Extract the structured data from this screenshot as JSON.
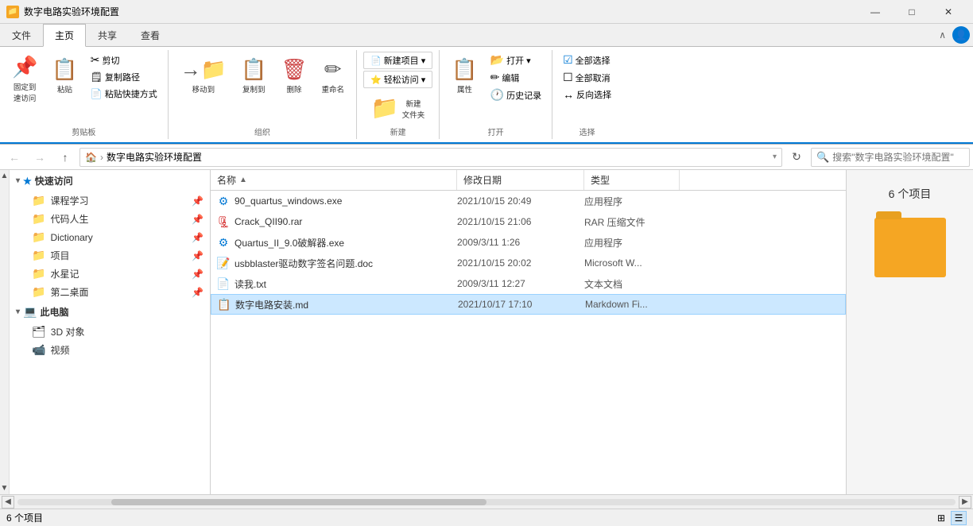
{
  "titleBar": {
    "title": "数字电路实验环境配置",
    "icon": "📁",
    "controls": {
      "minimize": "—",
      "maximize": "□",
      "close": "✕"
    }
  },
  "ribbon": {
    "tabs": [
      "文件",
      "主页",
      "共享",
      "查看"
    ],
    "activeTab": "主页",
    "groups": [
      {
        "label": "剪贴板",
        "items": [
          {
            "type": "large",
            "icon": "📌",
            "label": "固定到\n速访问"
          },
          {
            "type": "large",
            "icon": "📋",
            "label": "粘贴"
          },
          {
            "type": "col",
            "items": [
              {
                "icon": "✂",
                "label": "剪切"
              },
              {
                "icon": "🗒",
                "label": "复制路径"
              },
              {
                "icon": "📄",
                "label": "粘贴快捷方式"
              }
            ]
          }
        ]
      },
      {
        "label": "组织",
        "items": [
          {
            "type": "large",
            "icon": "➡",
            "label": "移动到"
          },
          {
            "type": "large",
            "icon": "📋",
            "label": "复制到"
          },
          {
            "type": "large",
            "icon": "🗑",
            "label": "删除"
          },
          {
            "type": "large",
            "icon": "✏",
            "label": "重命名"
          }
        ]
      },
      {
        "label": "新建",
        "items": [
          {
            "type": "large-split",
            "icon": "📁",
            "label": "新建\n文件夹",
            "subItems": [
              "新建项目 ▾",
              "轻松访问 ▾"
            ]
          }
        ]
      },
      {
        "label": "打开",
        "items": [
          {
            "type": "large",
            "icon": "📂",
            "label": "属性"
          },
          {
            "type": "col",
            "items": [
              {
                "icon": "📂",
                "label": "打开 ▾"
              },
              {
                "icon": "✏",
                "label": "编辑"
              },
              {
                "icon": "🕐",
                "label": "历史记录"
              }
            ]
          }
        ]
      },
      {
        "label": "选择",
        "items": [
          {
            "type": "col",
            "items": [
              {
                "icon": "☑",
                "label": "全部选择"
              },
              {
                "icon": "☐",
                "label": "全部取消"
              },
              {
                "icon": "↔",
                "label": "反向选择"
              }
            ]
          }
        ]
      }
    ]
  },
  "addressBar": {
    "backBtn": "←",
    "forwardBtn": "→",
    "upBtn": "↑",
    "homeIcon": "🏠",
    "path": "数字电路实验环境配置",
    "refreshBtn": "↻",
    "searchPlaceholder": "搜索\"数字电路实验环境配置\""
  },
  "sidebar": {
    "quickAccess": {
      "header": "快速访问",
      "items": [
        {
          "label": "课程学习",
          "icon": "📁",
          "pinned": true
        },
        {
          "label": "代码人生",
          "icon": "📁",
          "pinned": true
        },
        {
          "label": "Dictionary",
          "icon": "📁",
          "pinned": true
        },
        {
          "label": "项目",
          "icon": "📁",
          "pinned": true
        },
        {
          "label": "水星记",
          "icon": "📁",
          "pinned": true
        },
        {
          "label": "第二桌面",
          "icon": "📁",
          "pinned": true
        }
      ]
    },
    "thisPC": {
      "header": "此电脑",
      "items": [
        {
          "label": "3D 对象",
          "icon": "🗂"
        },
        {
          "label": "视频",
          "icon": "📹"
        }
      ]
    }
  },
  "fileList": {
    "itemCount": "6 个项目",
    "columns": {
      "name": "名称",
      "date": "修改日期",
      "type": "类型"
    },
    "files": [
      {
        "name": "90_quartus_windows.exe",
        "icon": "⚙",
        "iconColor": "#0078d4",
        "date": "2021/10/15 20:49",
        "type": "应用程序"
      },
      {
        "name": "Crack_QII90.rar",
        "icon": "🗜",
        "iconColor": "#cc0000",
        "date": "2021/10/15 21:06",
        "type": "RAR 压缩文件"
      },
      {
        "name": "Quartus_II_9.0破解器.exe",
        "icon": "⚙",
        "iconColor": "#0078d4",
        "date": "2009/3/11 1:26",
        "type": "应用程序"
      },
      {
        "name": "usbblaster驱动数字签名问题.doc",
        "icon": "📝",
        "iconColor": "#2b579a",
        "date": "2021/10/15 20:02",
        "type": "Microsoft W..."
      },
      {
        "name": "读我.txt",
        "icon": "📄",
        "iconColor": "#555",
        "date": "2009/3/11 12:27",
        "type": "文本文档"
      },
      {
        "name": "数字电路安装.md",
        "icon": "📋",
        "iconColor": "#0078d4",
        "date": "2021/10/17 17:10",
        "type": "Markdown Fi...",
        "selected": true
      }
    ]
  },
  "statusBar": {
    "itemCount": "6 个项目",
    "viewButtons": [
      "⊞",
      "☰"
    ]
  }
}
